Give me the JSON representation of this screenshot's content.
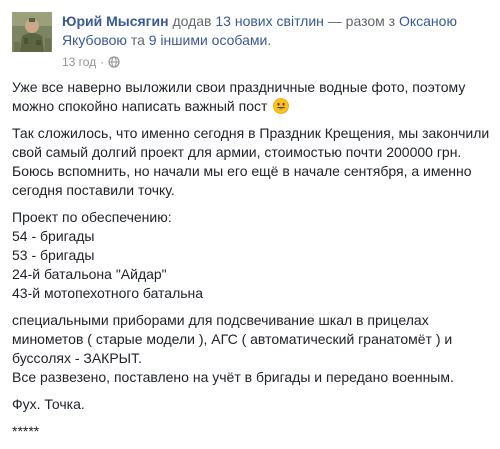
{
  "header": {
    "author": "Юрий Мысягин",
    "action": "додав",
    "photos": "13 нових світлин",
    "with_prefix": "— разом з",
    "person": "Оксаною Якубовою",
    "and": "та",
    "others": "9 іншими особами",
    "period": "."
  },
  "meta": {
    "time": "13 год",
    "separator": "·",
    "privacy_icon": "globe-icon"
  },
  "post": {
    "p1_text": "Уже все наверно выложили свои праздничные водные фото, поэтому можно спокойно написать важный пост",
    "p1_emoji": "smiling-face-emoji",
    "p2": "Так сложилось, что именно сегодня в Праздник Крещения, мы закончили свой самый долгий проект для армии, стоимостью почти 200000 грн. Боюсь вспомнить, но начали мы его ещё в начале сентября, а именно сегодня поставили точку.",
    "p3_lines": [
      "Проект по обеспечению:",
      "54 - бригады",
      "53 - бригады",
      "24-й батальона \"Айдар\"",
      "43-й мотопехотного батальна"
    ],
    "p4_lines": [
      "специальными приборами для подсвечивание шкал в прицелах минометов ( старые модели ), АГС ( автоматический гранатомёт ) и буссолях - ЗАКРЫТ.",
      "Все развезено, поставлено на учёт в бригады и передано военным."
    ],
    "p5": "Фух. Точка.",
    "p6": "*****"
  },
  "colors": {
    "link": "#385898",
    "text": "#1d2129",
    "meta": "#90949c",
    "header_gray": "#616770"
  }
}
